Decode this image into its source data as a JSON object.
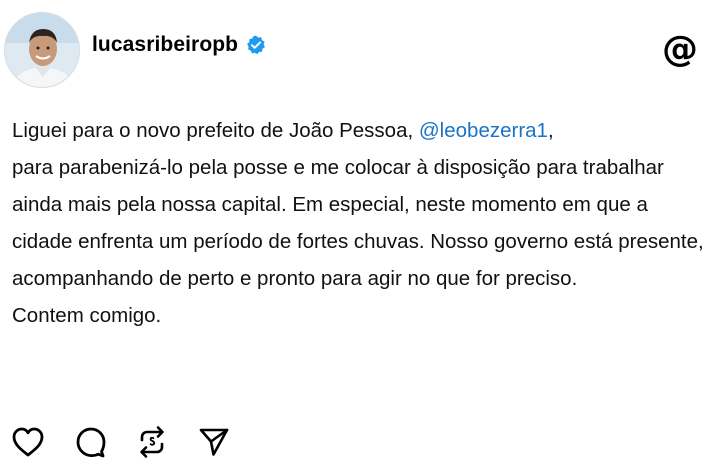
{
  "post": {
    "author": {
      "username": "lucasribeiropb",
      "verified": true,
      "avatar_icon": "profile-photo"
    },
    "app_icon": "threads-logo-icon",
    "app_glyph": "@",
    "body": {
      "line1_before": "Liguei para o novo prefeito de João Pessoa, ",
      "mention": "@leobezerra1",
      "line1_after": ",",
      "rest": "para parabenizá-lo pela posse e me colocar à disposição para trabalhar ainda mais pela nossa capital. Em especial, neste momento em que a cidade enfrenta um período de fortes chuvas. Nosso governo está presente, acompanhando de perto e pronto para agir no que for preciso.",
      "closing": "Contem comigo."
    },
    "actions": [
      {
        "name": "like",
        "icon": "heart-icon"
      },
      {
        "name": "comment",
        "icon": "speech-bubble-icon"
      },
      {
        "name": "repost",
        "icon": "repost-icon"
      },
      {
        "name": "share",
        "icon": "paper-plane-icon"
      }
    ]
  },
  "colors": {
    "mention": "#1a73c9",
    "verified_badge": "#1d9bf0",
    "text": "#111111",
    "background": "#ffffff"
  }
}
